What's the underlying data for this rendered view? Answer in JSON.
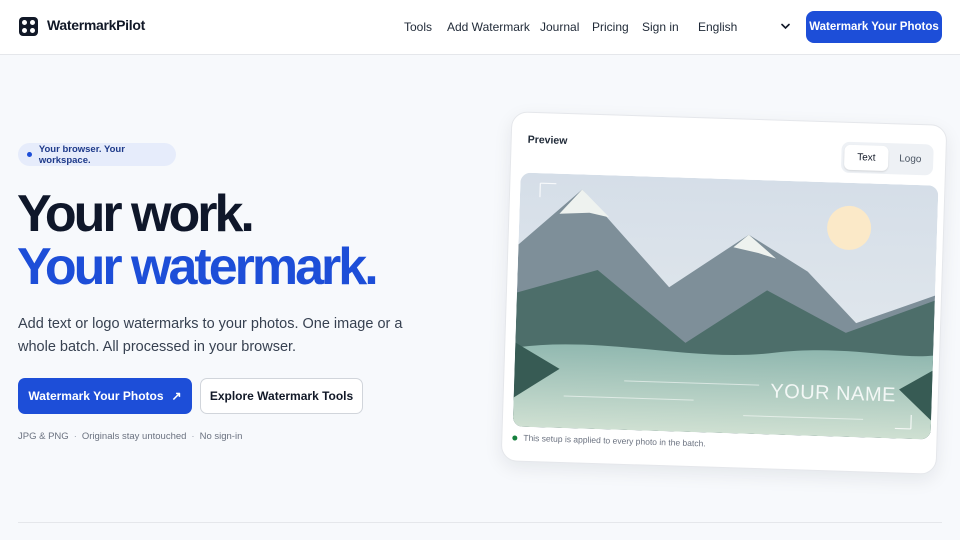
{
  "brand": {
    "name": "WatermarkPilot"
  },
  "nav": {
    "links": [
      "Tools",
      "Add Watermark",
      "Journal",
      "Pricing",
      "Sign in"
    ],
    "language": "English",
    "cta": "Watermark Your Photos"
  },
  "hero": {
    "badge": "Your browser. Your workspace.",
    "headline_line1": "Your work.",
    "headline_line2": "Your watermark.",
    "lead": "Add text or logo watermarks to your photos. One image or a whole batch. All processed in your browser.",
    "primary_cta": "Watermark Your Photos",
    "primary_cta_icon": "↗",
    "secondary_cta": "Explore Watermark Tools",
    "meta": [
      "JPG & PNG",
      "Originals stay untouched",
      "No sign-in"
    ]
  },
  "preview": {
    "title": "Preview",
    "modes": [
      "Text",
      "Logo"
    ],
    "selected_mode": "Text",
    "watermark_text": "YOUR NAME",
    "footnote": "This setup is applied to every photo in the batch."
  },
  "colors": {
    "accent": "#1d4ed8",
    "ink": "#0f172a",
    "status_dot": "#15803d"
  }
}
